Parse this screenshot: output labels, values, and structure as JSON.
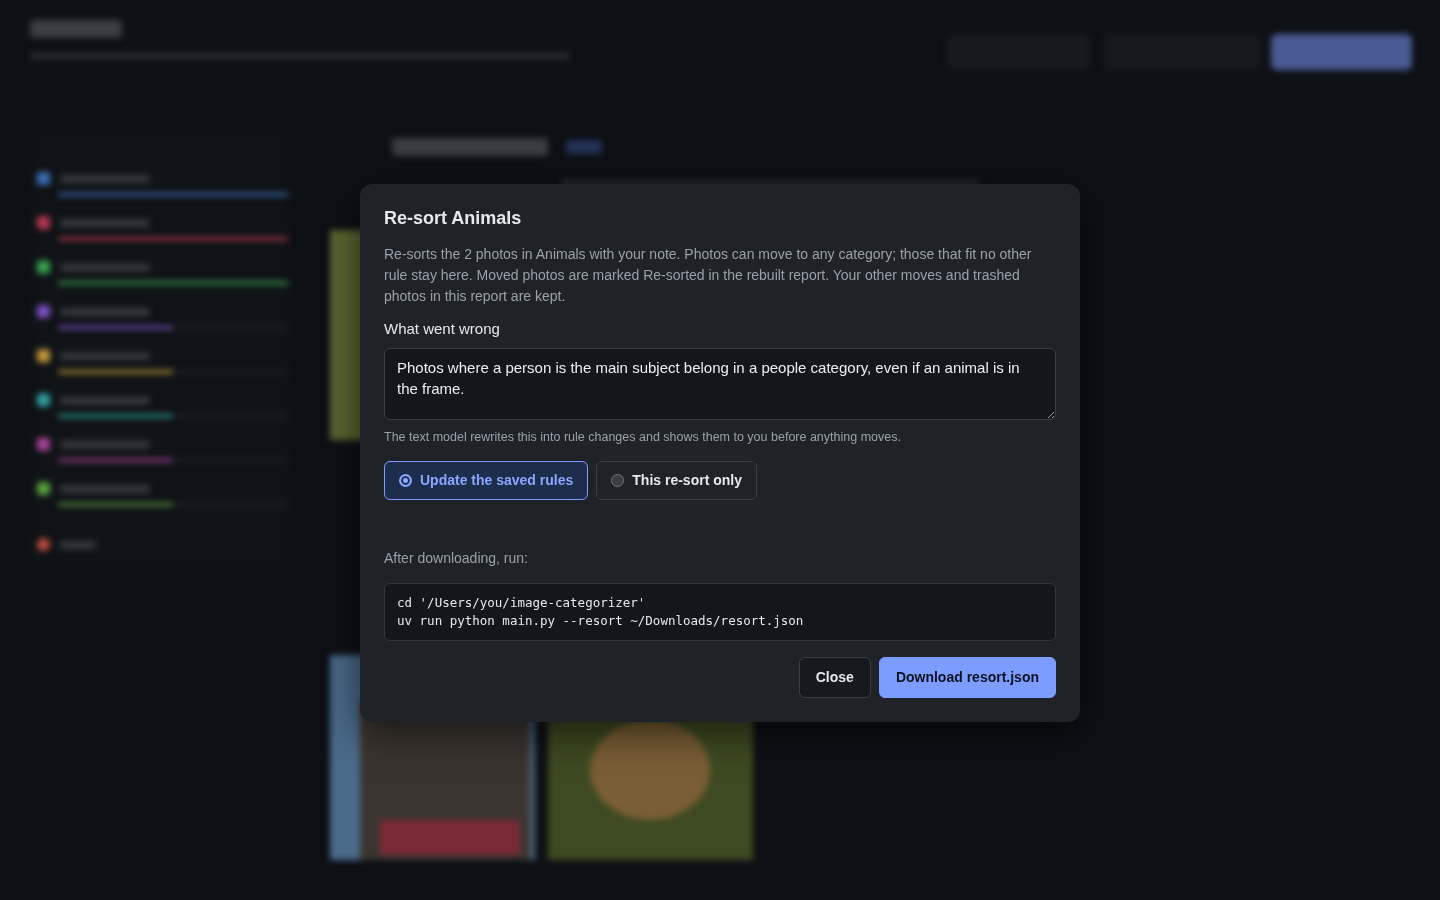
{
  "dialog": {
    "title": "Re-sort Animals",
    "description": "Re-sorts the 2 photos in Animals with your note. Photos can move to any category; those that fit no other rule stay here. Moved photos are marked Re-sorted in the rebuilt report. Your other moves and trashed photos in this report are kept.",
    "field_label": "What went wrong",
    "note": "Photos where a person is the main subject belong in a people category, even if an animal is in the frame.",
    "help": "The text model rewrites this into rule changes and shows them to you before anything moves.",
    "options": [
      {
        "label": "Update the saved rules",
        "selected": true
      },
      {
        "label": "This re-sort only",
        "selected": false
      }
    ],
    "command_label": "After downloading, run:",
    "command": [
      "cd '/Users/you/image-categorizer'",
      "uv run python main.py --resort ~/Downloads/resort.json"
    ],
    "buttons": [
      {
        "label": "Close",
        "kind": "secondary"
      },
      {
        "label": "Download resort.json",
        "kind": "primary"
      }
    ]
  }
}
